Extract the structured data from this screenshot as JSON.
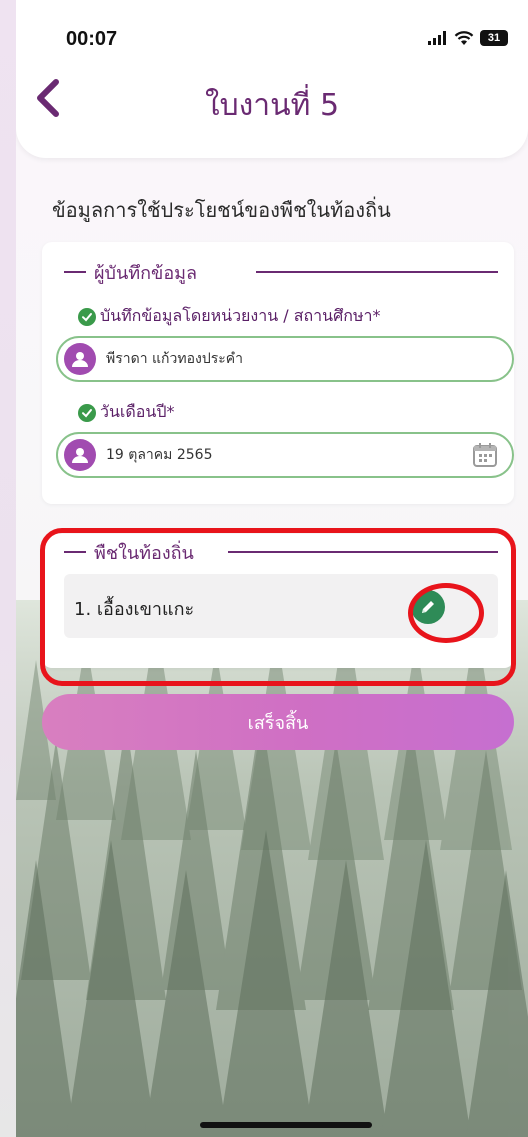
{
  "status_bar": {
    "time": "00:07",
    "battery": "31"
  },
  "header": {
    "title": "ใบงานที่ 5"
  },
  "section": {
    "title": "ข้อมูลการใช้ประโยชน์ของพืชในท้องถิ่น"
  },
  "recorder": {
    "legend": "ผู้บันทึกข้อมูล",
    "org_label": "บันทึกข้อมูลโดยหน่วยงาน / สถานศึกษา*",
    "org_value": "พีราดา แก้วทองประคำ",
    "date_label": "วันเดือนปี*",
    "date_value": "19 ตุลาคม 2565"
  },
  "plants": {
    "legend": "พืชในท้องถิ่น",
    "items": [
      {
        "label": "1. เอื้องเขาแกะ"
      }
    ]
  },
  "actions": {
    "finish_label": "เสร็จสิ้น"
  },
  "colors": {
    "accent": "#6a2a72",
    "field_border": "#88c28a",
    "check_green": "#3a9a4a",
    "edit_green": "#2e8b57",
    "highlight_red": "#e8141b",
    "button_pink": "#d87fc0"
  }
}
